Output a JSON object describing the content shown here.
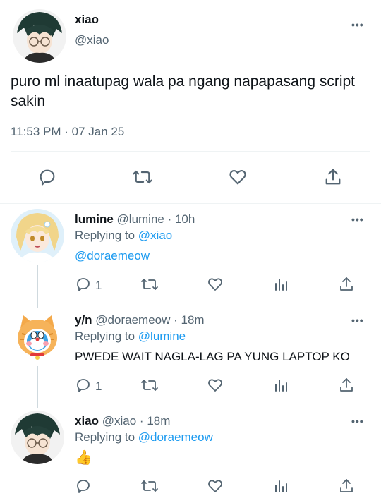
{
  "main_tweet": {
    "display_name": "xiao",
    "handle": "@xiao",
    "text": "puro ml inaatupag wala pa ngang napapasang script sakin",
    "timestamp": "11:53 PM · 07 Jan 25",
    "more_label": "•••",
    "actions": [
      "reply-icon",
      "retweet-icon",
      "like-icon",
      "share-icon"
    ]
  },
  "replies": [
    {
      "display_name": "lumine",
      "meta": "@lumine · 10h",
      "replying_prefix": "Replying to ",
      "replying_to": "@xiao",
      "text": "@doraemeow",
      "reply_count": "1",
      "more_label": "•••"
    },
    {
      "display_name": "y/n",
      "meta": "@doraemeow · 18m",
      "replying_prefix": "Replying to ",
      "replying_to": "@lumine",
      "text": "PWEDE WAIT NAGLA-LAG PA YUNG LAPTOP KO",
      "reply_count": "1",
      "more_label": "•••"
    },
    {
      "display_name": "xiao",
      "meta": "@xiao · 18m",
      "replying_prefix": "Replying to ",
      "replying_to": "@doraemeow",
      "text": "👍",
      "reply_count": "",
      "more_label": "•••"
    }
  ],
  "colors": {
    "accent": "#1d9bf0",
    "text": "#0f1419",
    "muted": "#536471",
    "divider": "#eff3f4"
  }
}
